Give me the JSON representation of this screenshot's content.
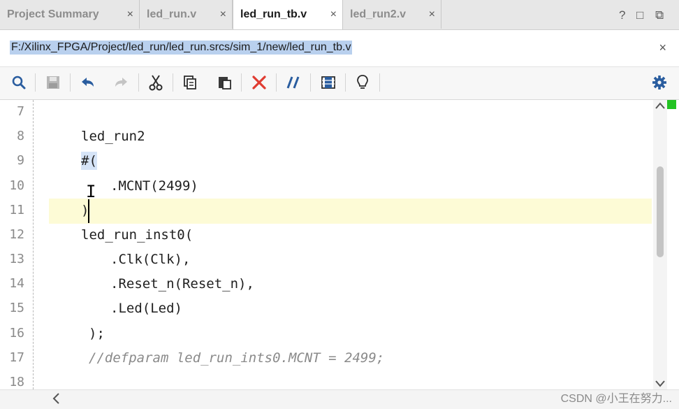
{
  "tabs": [
    {
      "label": "Project Summary",
      "active": false
    },
    {
      "label": "led_run.v",
      "active": false
    },
    {
      "label": "led_run_tb.v",
      "active": true
    },
    {
      "label": "led_run2.v",
      "active": false
    }
  ],
  "tab_close_glyph": "×",
  "window_controls": {
    "help": "?",
    "restore": "□",
    "float": "⧉"
  },
  "file_path": "F:/Xilinx_FPGA/Project/led_run/led_run.srcs/sim_1/new/led_run_tb.v",
  "path_close": "×",
  "toolbar": {
    "icons": [
      "search-icon",
      "save-icon",
      "undo-icon",
      "redo-icon",
      "cut-icon",
      "copy-icon",
      "paste-icon",
      "delete-icon",
      "comment-icon",
      "block-select-icon",
      "lightbulb-icon"
    ],
    "settings_icon": "gear-icon"
  },
  "editor": {
    "lines": [
      {
        "n": "7",
        "text": ""
      },
      {
        "n": "8",
        "text": "led_run2"
      },
      {
        "n": "9",
        "text": "#("
      },
      {
        "n": "10",
        "text": ".MCNT(2499)"
      },
      {
        "n": "11",
        "text": ")"
      },
      {
        "n": "12",
        "text": "led_run_inst0("
      },
      {
        "n": "13",
        "text": ".Clk(Clk),"
      },
      {
        "n": "14",
        "text": ".Reset_n(Reset_n),"
      },
      {
        "n": "15",
        "text": ".Led(Led)"
      },
      {
        "n": "16",
        "text": ");"
      },
      {
        "n": "17",
        "text": "//defparam led_run_ints0.MCNT = 2499;"
      },
      {
        "n": "18",
        "text": ""
      }
    ],
    "current_line": "11"
  },
  "colors": {
    "accent_green": "#22c322",
    "path_highlight": "#b9d0ee",
    "current_line": "#fdfbd6",
    "delete_red": "#e03c31",
    "icon_blue": "#2a5d9f"
  },
  "watermark": "CSDN @小王在努力..."
}
